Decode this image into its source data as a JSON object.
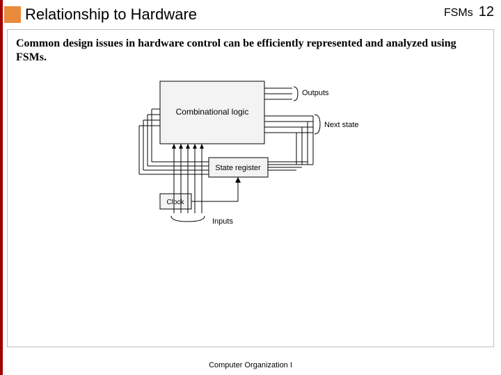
{
  "header": {
    "title": "Relationship to Hardware",
    "rightLabel": "FSMs",
    "pageNum": "12",
    "accentColor": "#e98a3c",
    "stripeColor": "#a00000"
  },
  "body": {
    "paragraph": "Common design issues in hardware control can be efficiently represented and analyzed using FSMs."
  },
  "diagram": {
    "blocks": {
      "combLogic": "Combinational logic",
      "stateRegister": "State register",
      "clock": "Clock"
    },
    "labels": {
      "outputs": "Outputs",
      "nextState": "Next state",
      "inputs": "Inputs"
    }
  },
  "footer": {
    "text": "Computer Organization I"
  }
}
